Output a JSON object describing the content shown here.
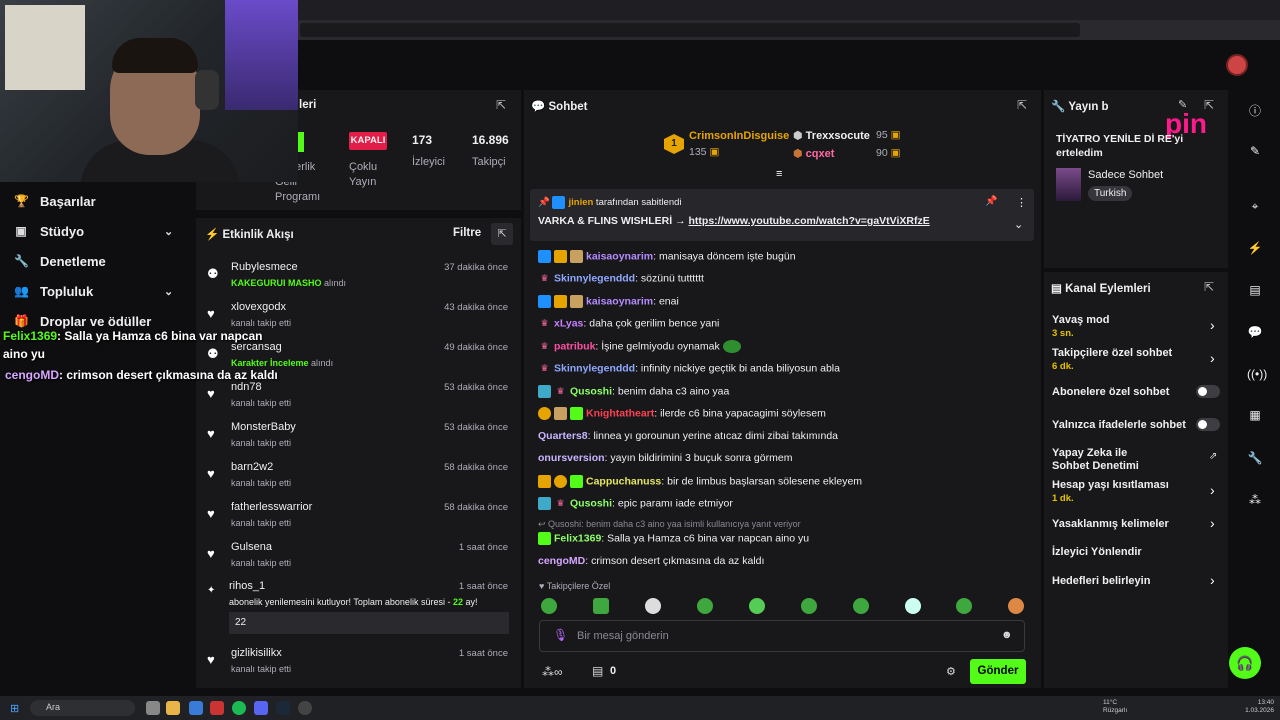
{
  "stream_stats": {
    "status_badge": "KAPALI",
    "partner_program": "Gelir Programı",
    "partner_partial": "nerlik",
    "multi_stream": "Çoklu Yayın",
    "viewers_value": "173",
    "viewers_label": "İzleyici",
    "followers_value": "16.896",
    "followers_label": "Takipçi",
    "panel_partial_title": "leri"
  },
  "left_nav": {
    "items": [
      {
        "label": "Başarılar",
        "icon": "trophy-icon"
      },
      {
        "label": "Stüdyo",
        "icon": "studio-icon"
      },
      {
        "label": "Denetleme",
        "icon": "wrench-icon"
      },
      {
        "label": "Topluluk",
        "icon": "community-icon"
      },
      {
        "label": "Droplar ve ödüller",
        "icon": "gift-icon"
      }
    ]
  },
  "overlay_chat": [
    {
      "user": "Felix1369",
      "text": ": Salla ya Hamza c6 bina var napcan",
      "cont": "aino yu"
    },
    {
      "user": "cengoMD",
      "text": ": crimson desert çıkmasına da az kaldı"
    }
  ],
  "activity": {
    "title": "Etkinlik Akışı",
    "filter": "Filtre",
    "rows": [
      {
        "name": "Rubylesmece",
        "sub": "KAKEGURUI MASHO",
        "sub2": " alındı",
        "time": "37 dakika önce",
        "icon": "reward-icon"
      },
      {
        "name": "xlovexgodx",
        "sub": "kanalı takip etti",
        "time": "43 dakika önce",
        "icon": "heart-icon"
      },
      {
        "name": "sercansag",
        "sub": "Karakter İnceleme",
        "sub2": " alındı",
        "time": "49 dakika önce",
        "icon": "reward-icon"
      },
      {
        "name": "ndn78",
        "sub": "kanalı takip etti",
        "time": "53 dakika önce",
        "icon": "heart-icon"
      },
      {
        "name": "MonsterBaby",
        "sub": "kanalı takip etti",
        "time": "53 dakika önce",
        "icon": "heart-icon"
      },
      {
        "name": "barn2w2",
        "sub": "kanalı takip etti",
        "time": "58 dakika önce",
        "icon": "heart-icon"
      },
      {
        "name": "fatherlesswarrior",
        "sub": "kanalı takip etti",
        "time": "58 dakika önce",
        "icon": "heart-icon"
      },
      {
        "name": "Gulsena",
        "sub": "kanalı takip etti",
        "time": "1 saat önce",
        "icon": "heart-icon"
      }
    ],
    "resub": {
      "name": "rihos_1",
      "time": "1 saat önce",
      "text": "abonelik yenilemesini kutluyor! Toplam abonelik süresi - ",
      "months": "22",
      "suffix": " ay!",
      "message": "22"
    },
    "last": {
      "name": "gizlikisilikx",
      "sub": "kanalı takip etti",
      "time": "1 saat önce"
    }
  },
  "chat": {
    "title": "Sohbet",
    "leaderboard": [
      {
        "rank": "1",
        "name": "CrimsonInDisguise",
        "points": "135"
      },
      {
        "name": "Trexxsocute",
        "points": "95"
      },
      {
        "name": "cqxet",
        "points": "90"
      }
    ],
    "pinned": {
      "by": "jinien",
      "by_suffix": " tarafından sabitlendi",
      "text": "VARKA & FLINS WISHLERİ → ",
      "link": "https://www.youtube.com/watch?v=gaVtViXRfzE"
    },
    "messages": [
      {
        "user": "kaisaoynarim",
        "color": "#b48cff",
        "text": ": manisaya döncem işte bugün"
      },
      {
        "user": "Skinnylegenddd",
        "color": "#8fa8ff",
        "text": ": sözünü tutttttt"
      },
      {
        "user": "kaisaoynarim",
        "color": "#b48cff",
        "text": ": enai"
      },
      {
        "user": "xLyas",
        "color": "#c77dff",
        "text": ": daha çok gerilim bence yani"
      },
      {
        "user": "patribuk",
        "color": "#ff4fa3",
        "text": ": İşine gelmiyodu oynamak"
      },
      {
        "user": "Skinnylegenddd",
        "color": "#8fa8ff",
        "text": ": infinity nickiye geçtik bi anda biliyosun abla"
      },
      {
        "user": "Qusoshi",
        "color": "#8cff66",
        "text": ": benim daha c3 aino yaa"
      },
      {
        "user": "Knightatheart",
        "color": "#ff4050",
        "text": ": ilerde c6 bina yapacagimi söylesem"
      },
      {
        "user": "Quarters8",
        "color": "#c9b6ff",
        "text": ": linnea yı gorounun yerine atıcaz dimi zibai takımında"
      },
      {
        "user": "onursversion",
        "color": "#c9b6ff",
        "text": ": yayın bildirimini 3 buçuk sonra görmem"
      },
      {
        "user": "Cappuchanuss",
        "color": "#e6e65c",
        "text": ": bir de limbus başlarsan sölesene ekleyem"
      },
      {
        "user": "Qusoshi",
        "color": "#8cff66",
        "text": ": epic paramı iade etmiyor"
      }
    ],
    "reply_context": "Qusoshi: benim daha c3 aino yaa isimli kullanıcıya yanıt veriyor",
    "reply": {
      "user": "Felix1369",
      "color": "#8cff66",
      "text": ": Salla ya Hamza c6 bina var napcan aino yu"
    },
    "last": {
      "user": "cengoMD",
      "color": "#d6a6ff",
      "text": ": crimson desert çıkmasına da az kaldı"
    },
    "followers_only": "Takipçilere Özel",
    "input_placeholder": "Bir mesaj gönderin",
    "points_count": "0",
    "send": "Gönder"
  },
  "stream_info": {
    "title": "Yayın b",
    "game_text": "TİYATRO YENİLE   Dİ   RE'yi erteledim",
    "chat_mode": "Sadece Sohbet",
    "tag": "Turkish",
    "logo_text": "pin"
  },
  "channel_actions": {
    "title": "Kanal Eylemleri",
    "items": [
      {
        "label": "Yavaş mod",
        "sub": "3 sn."
      },
      {
        "label": "Takipçilere özel sohbet",
        "sub": "6 dk."
      },
      {
        "label": "Abonelere özel sohbet"
      },
      {
        "label": "Yalnızca ifadelerle sohbet"
      },
      {
        "label": "Yapay Zeka ile Sohbet Denetimi"
      },
      {
        "label": "Hesap yaşı kısıtlaması",
        "sub": "1 dk."
      },
      {
        "label": "Yasaklanmış kelimeler"
      },
      {
        "label": "İzleyici Yönlendir"
      },
      {
        "label": "Hedefleri belirleyin"
      }
    ]
  },
  "taskbar": {
    "search": "Ara",
    "temp": "11°C",
    "weather": "Rüzgarlı",
    "time": "13:40",
    "date": "1.03.2026"
  },
  "colors": {
    "accent": "#53fc18",
    "bg": "#0e0e10",
    "panel": "#18181b",
    "kapali": "#e11d48"
  }
}
